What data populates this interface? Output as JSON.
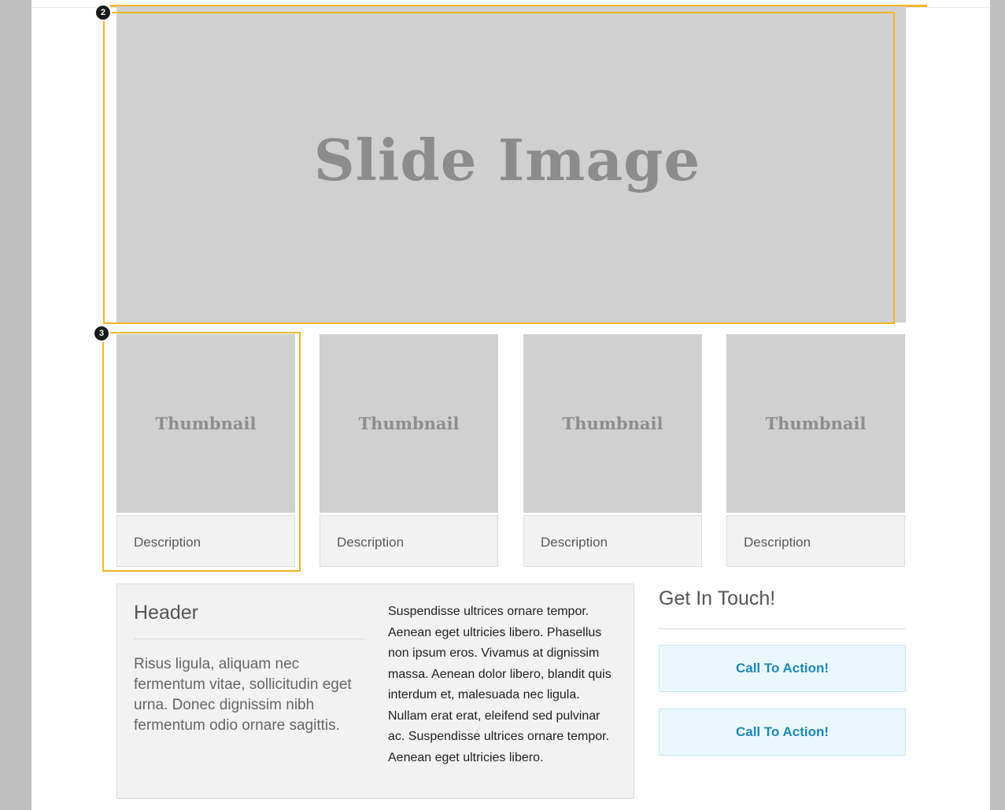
{
  "slide": {
    "label": "Slide Image"
  },
  "annotations": [
    {
      "label": "2"
    },
    {
      "label": "3"
    }
  ],
  "thumbnails": [
    {
      "image_label": "Thumbnail",
      "description": "Description"
    },
    {
      "image_label": "Thumbnail",
      "description": "Description"
    },
    {
      "image_label": "Thumbnail",
      "description": "Description"
    },
    {
      "image_label": "Thumbnail",
      "description": "Description"
    }
  ],
  "content": {
    "header": "Header",
    "left_text": "Risus ligula, aliquam nec fermentum vitae, sollicitudin eget urna. Donec dignissim nibh fermentum odio ornare sagittis.",
    "right_text": "Suspendisse ultrices ornare tempor. Aenean eget ultricies libero. Phasellus non ipsum eros. Vivamus at dignissim massa. Aenean dolor libero, blandit quis interdum et, malesuada nec ligula. Nullam erat erat, eleifend sed pulvinar ac. Suspendisse ultrices ornare tempor. Aenean eget ultricies libero."
  },
  "contact": {
    "title": "Get In Touch!",
    "buttons": [
      "Call To Action!",
      "Call To Action!"
    ]
  },
  "colors": {
    "annotation": "#f0b62b",
    "placeholder": "#d0d0d0",
    "cta_text": "#1f86b8",
    "cta_background": "#eaf8fd"
  }
}
